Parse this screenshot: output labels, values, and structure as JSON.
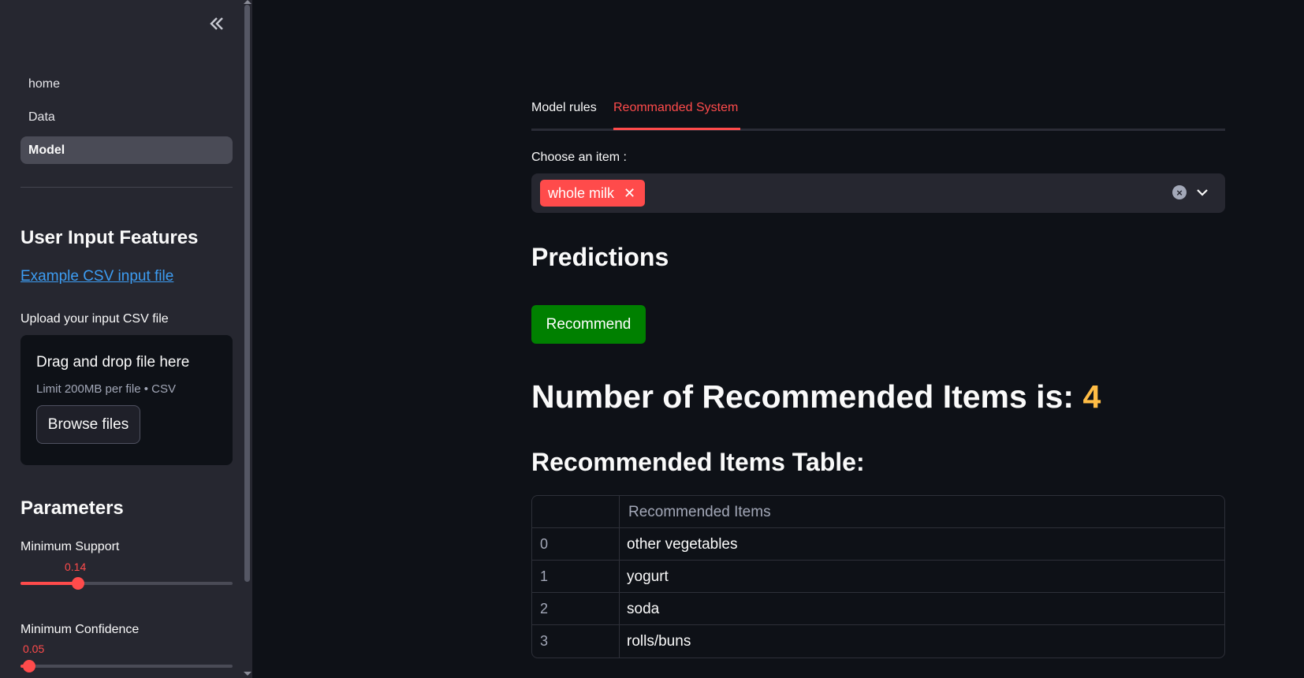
{
  "sidebar": {
    "nav": [
      "home",
      "Data",
      "Model"
    ],
    "active_nav": "Model",
    "user_input_title": "User Input Features",
    "example_link": "Example CSV input file",
    "upload_label": "Upload your input CSV file",
    "dropzone_title": "Drag and drop file here",
    "dropzone_sub": "Limit 200MB per file • CSV",
    "browse_label": "Browse files",
    "params_title": "Parameters",
    "min_support_label": "Minimum Support",
    "min_support_value": "0.14",
    "min_support_fraction": 0.27,
    "min_conf_label": "Minimum Confidence",
    "min_conf_value": "0.05",
    "min_conf_fraction": 0.04
  },
  "main": {
    "tabs": [
      "Model rules",
      "Reommanded System"
    ],
    "active_tab": "Reommanded System",
    "select_label": "Choose an item :",
    "selected_item": "whole milk",
    "predictions_title": "Predictions",
    "recommend_label": "Recommend",
    "count_title": "Number of Recommended Items is:",
    "count_value": "4",
    "table_title": "Recommended Items Table:",
    "table": {
      "header": "Recommended Items",
      "rows": [
        {
          "idx": "0",
          "item": "other vegetables"
        },
        {
          "idx": "1",
          "item": "yogurt"
        },
        {
          "idx": "2",
          "item": "soda"
        },
        {
          "idx": "3",
          "item": "rolls/buns"
        }
      ]
    }
  },
  "colors": {
    "accent": "#ff4b4b",
    "button_green": "#008000",
    "count_orange": "#ffbd45",
    "link_blue": "#3d9df3"
  }
}
